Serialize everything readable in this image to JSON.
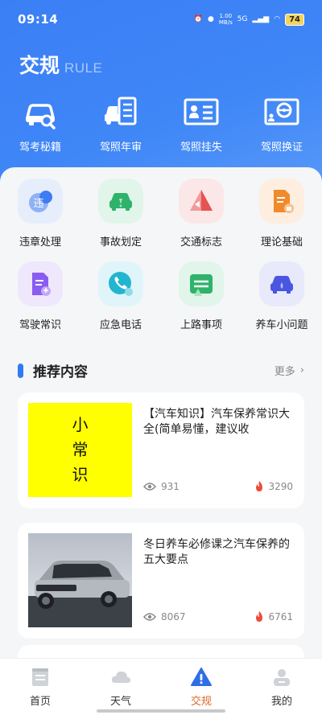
{
  "status_bar": {
    "time": "09:14",
    "net_speed": "1.00",
    "net_unit": "MB/s",
    "signal": "5G",
    "battery": "74"
  },
  "header": {
    "title_zh": "交规",
    "title_en": "RULE"
  },
  "top_menu": [
    {
      "label": "驾考秘籍",
      "icon": "car-search-icon"
    },
    {
      "label": "驾照年审",
      "icon": "license-checklist-icon"
    },
    {
      "label": "驾照挂失",
      "icon": "id-card-icon"
    },
    {
      "label": "驾照换证",
      "icon": "steering-card-icon"
    }
  ],
  "grid": [
    {
      "label": "违章处理",
      "icon": "violation-icon",
      "icon_text": "违",
      "color": "#3e7cf2",
      "bg": "#e6eefc"
    },
    {
      "label": "事故划定",
      "icon": "accident-car-icon",
      "color": "#2fb36b",
      "bg": "#e1f5ea"
    },
    {
      "label": "交通标志",
      "icon": "traffic-sign-icon",
      "color": "#e55353",
      "bg": "#fbe7e7"
    },
    {
      "label": "理论基础",
      "icon": "theory-document-icon",
      "color": "#f08a2a",
      "bg": "#fdeee0"
    },
    {
      "label": "驾驶常识",
      "icon": "driving-knowledge-icon",
      "color": "#8a5cf0",
      "bg": "#efe8fd"
    },
    {
      "label": "应急电话",
      "icon": "emergency-phone-icon",
      "color": "#22b5cf",
      "bg": "#e0f5f9"
    },
    {
      "label": "上路事项",
      "icon": "road-notice-icon",
      "color": "#2fb36b",
      "bg": "#e1f5ea"
    },
    {
      "label": "养车小问题",
      "icon": "car-care-icon",
      "color": "#4a56e0",
      "bg": "#e8e9fb"
    }
  ],
  "recommend": {
    "title": "推荐内容",
    "more": "更多"
  },
  "articles": [
    {
      "title": "【汽车知识】汽车保养常识大全(简单易懂，建议收",
      "views": "931",
      "hot": "3290",
      "thumb_text": [
        "小",
        "常",
        "识"
      ]
    },
    {
      "title": "冬日养车必修课之汽车保养的五大要点",
      "views": "8067",
      "hot": "6761"
    }
  ],
  "tabs": [
    {
      "label": "首页",
      "icon": "home-icon",
      "active": false
    },
    {
      "label": "天气",
      "icon": "weather-cloud-icon",
      "active": false
    },
    {
      "label": "交规",
      "icon": "warning-triangle-icon",
      "active": true
    },
    {
      "label": "我的",
      "icon": "profile-icon",
      "active": false
    }
  ],
  "colors": {
    "header_blue": "#3b7ff5",
    "accent_blue": "#2f7bf6",
    "active_tab": "#e0692a",
    "hot_red": "#ef4b3a"
  }
}
